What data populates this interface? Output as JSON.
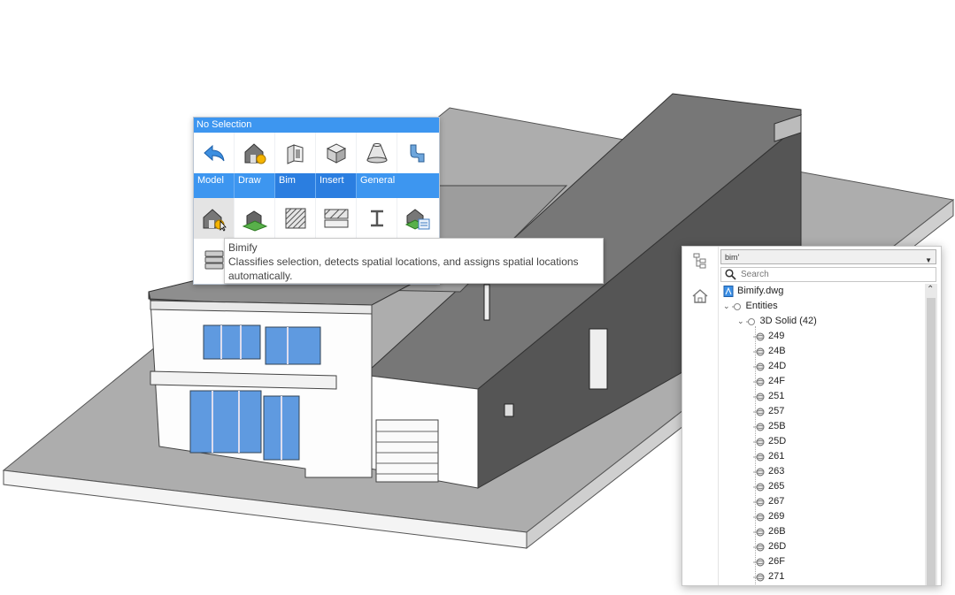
{
  "quad": {
    "title": "No Selection",
    "tabs": [
      {
        "label": "Model"
      },
      {
        "label": "Draw"
      },
      {
        "label": "Bim"
      },
      {
        "label": "Insert"
      },
      {
        "label": "General"
      }
    ],
    "row1_icons": [
      "undo-icon",
      "bim-house-icon",
      "wall-icon",
      "box-icon",
      "solid-frustum-icon",
      "pipe-icon"
    ],
    "row2_icons": [
      "bimify-icon",
      "bim-building-icon",
      "hatch-icon",
      "slab-icon",
      "beam-icon",
      "bim-classify-icon"
    ],
    "accent": "#3d96f0"
  },
  "tooltip": {
    "title": "Bimify",
    "description": "Classifies selection, detects spatial locations, and assigns spatial locations automatically."
  },
  "browser": {
    "filter_value": "bim'",
    "search_placeholder": "Search",
    "file": "Bimify.dwg",
    "entities_label": "Entities",
    "solid_label": "3D Solid (42)",
    "items": [
      "249",
      "24B",
      "24D",
      "24F",
      "251",
      "257",
      "25B",
      "25D",
      "261",
      "263",
      "265",
      "267",
      "269",
      "26B",
      "26D",
      "26F",
      "271"
    ]
  }
}
